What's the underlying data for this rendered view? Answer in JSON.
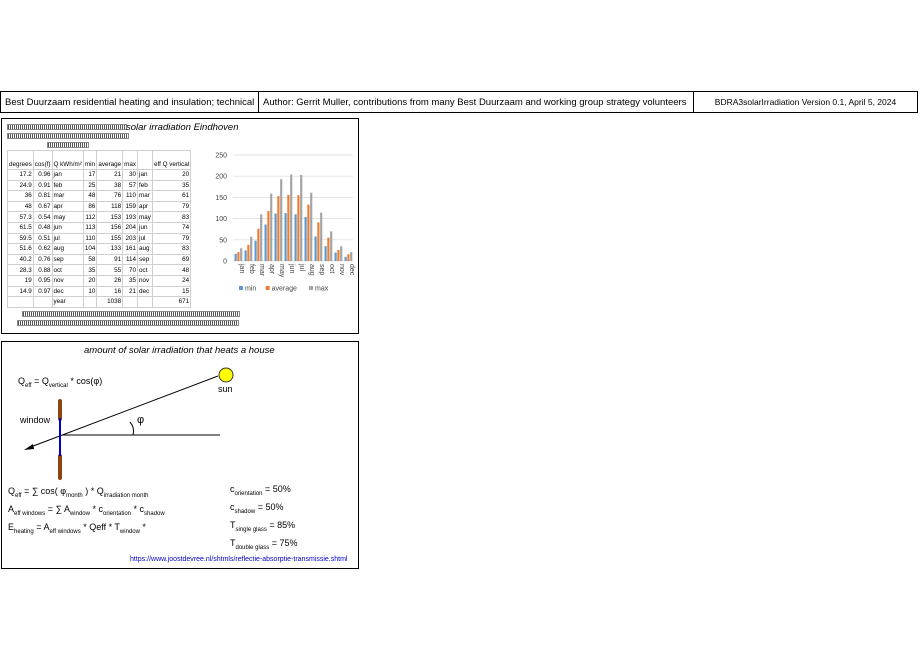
{
  "header": {
    "title": "Best Duurzaam residential heating and insulation; technical",
    "author": "Author: Gerrit Muller, contributions from many Best Duurzaam and working group strategy volunteers",
    "version": "BDRA3solarIrradiation Version 0.1, April 5, 2024"
  },
  "panel1": {
    "title": "solar irradiation Eindhoven",
    "table": {
      "headers": [
        "degrees",
        "cos(f)",
        "Q kWh/m²",
        "min",
        "average",
        "max",
        "",
        "eff Q vertical"
      ],
      "rows": [
        [
          "17.2",
          "0.96",
          "jan",
          "17",
          "21",
          "30",
          "jan",
          "20"
        ],
        [
          "24.9",
          "0.91",
          "feb",
          "25",
          "38",
          "57",
          "feb",
          "35"
        ],
        [
          "36",
          "0.81",
          "mar",
          "48",
          "76",
          "110",
          "mar",
          "61"
        ],
        [
          "48",
          "0.67",
          "apr",
          "86",
          "118",
          "159",
          "apr",
          "79"
        ],
        [
          "57.3",
          "0.54",
          "may",
          "112",
          "153",
          "193",
          "may",
          "83"
        ],
        [
          "61.5",
          "0.48",
          "jun",
          "113",
          "156",
          "204",
          "jun",
          "74"
        ],
        [
          "59.5",
          "0.51",
          "jul",
          "110",
          "155",
          "203",
          "jul",
          "79"
        ],
        [
          "51.6",
          "0.62",
          "aug",
          "104",
          "133",
          "161",
          "aug",
          "83"
        ],
        [
          "40.2",
          "0.76",
          "sep",
          "58",
          "91",
          "114",
          "sep",
          "69"
        ],
        [
          "28.3",
          "0.88",
          "oct",
          "35",
          "55",
          "70",
          "oct",
          "48"
        ],
        [
          "19",
          "0.95",
          "nov",
          "20",
          "26",
          "35",
          "nov",
          "24"
        ],
        [
          "14.9",
          "0.97",
          "dec",
          "10",
          "16",
          "21",
          "dec",
          "15"
        ]
      ],
      "total": [
        "",
        "",
        "year",
        "",
        "1038",
        "",
        "",
        "671"
      ]
    }
  },
  "chart_data": {
    "type": "bar",
    "categories": [
      "jan",
      "feb",
      "mar",
      "apr",
      "may",
      "jun",
      "jul",
      "aug",
      "sep",
      "oct",
      "nov",
      "dec"
    ],
    "series": [
      {
        "name": "min",
        "values": [
          17,
          25,
          48,
          86,
          112,
          113,
          110,
          104,
          58,
          35,
          20,
          10
        ],
        "color": "#5b9bd5"
      },
      {
        "name": "average",
        "values": [
          21,
          38,
          76,
          118,
          153,
          156,
          155,
          133,
          91,
          55,
          26,
          16
        ],
        "color": "#ed7d31"
      },
      {
        "name": "max",
        "values": [
          30,
          57,
          110,
          159,
          193,
          204,
          203,
          161,
          114,
          70,
          35,
          21
        ],
        "color": "#a5a5a5"
      }
    ],
    "ylim": [
      0,
      250
    ],
    "yticks": [
      "0",
      "50",
      "100",
      "150",
      "200",
      "250"
    ],
    "grid": true,
    "legend": "bottom"
  },
  "panel2": {
    "title": "amount of solar irradiation that heats a house",
    "sun_label": "sun",
    "window_label": "window",
    "phi": "φ",
    "link": "https://www.joostdevree.nl/shtmls/reflectie-absorptie-transmissie.shtml",
    "f_top": {
      "a": "Q",
      "b": "eff",
      "c": " = Q",
      "d": "vertical",
      "e": " * cos(φ)"
    },
    "f1": {
      "a": "Q",
      "b": "eff",
      "c": " = ∑ cos( φ",
      "d": "month",
      "e": " ) * Q",
      "f": "irradiation month"
    },
    "f2": {
      "a": "A",
      "b": "eff windows",
      "c": " = ∑ A",
      "d": "window",
      "e": " * c",
      "f": "orientation",
      "g": " * c",
      "h": "shadow"
    },
    "f3": {
      "a": "E",
      "b": "heating",
      "c": " =  A",
      "d": "eff windows",
      "e": " * Qeff * T",
      "f": "window",
      "g": " *"
    },
    "c1": {
      "a": "c",
      "b": "orientation",
      "c": " = 50%"
    },
    "c2": {
      "a": "c",
      "b": "shadow",
      "c": " = 50%"
    },
    "c3": {
      "a": "T",
      "b": "single glass",
      "c": " = 85%"
    },
    "c4": {
      "a": "T",
      "b": "double glass",
      "c": " = 75%"
    }
  }
}
